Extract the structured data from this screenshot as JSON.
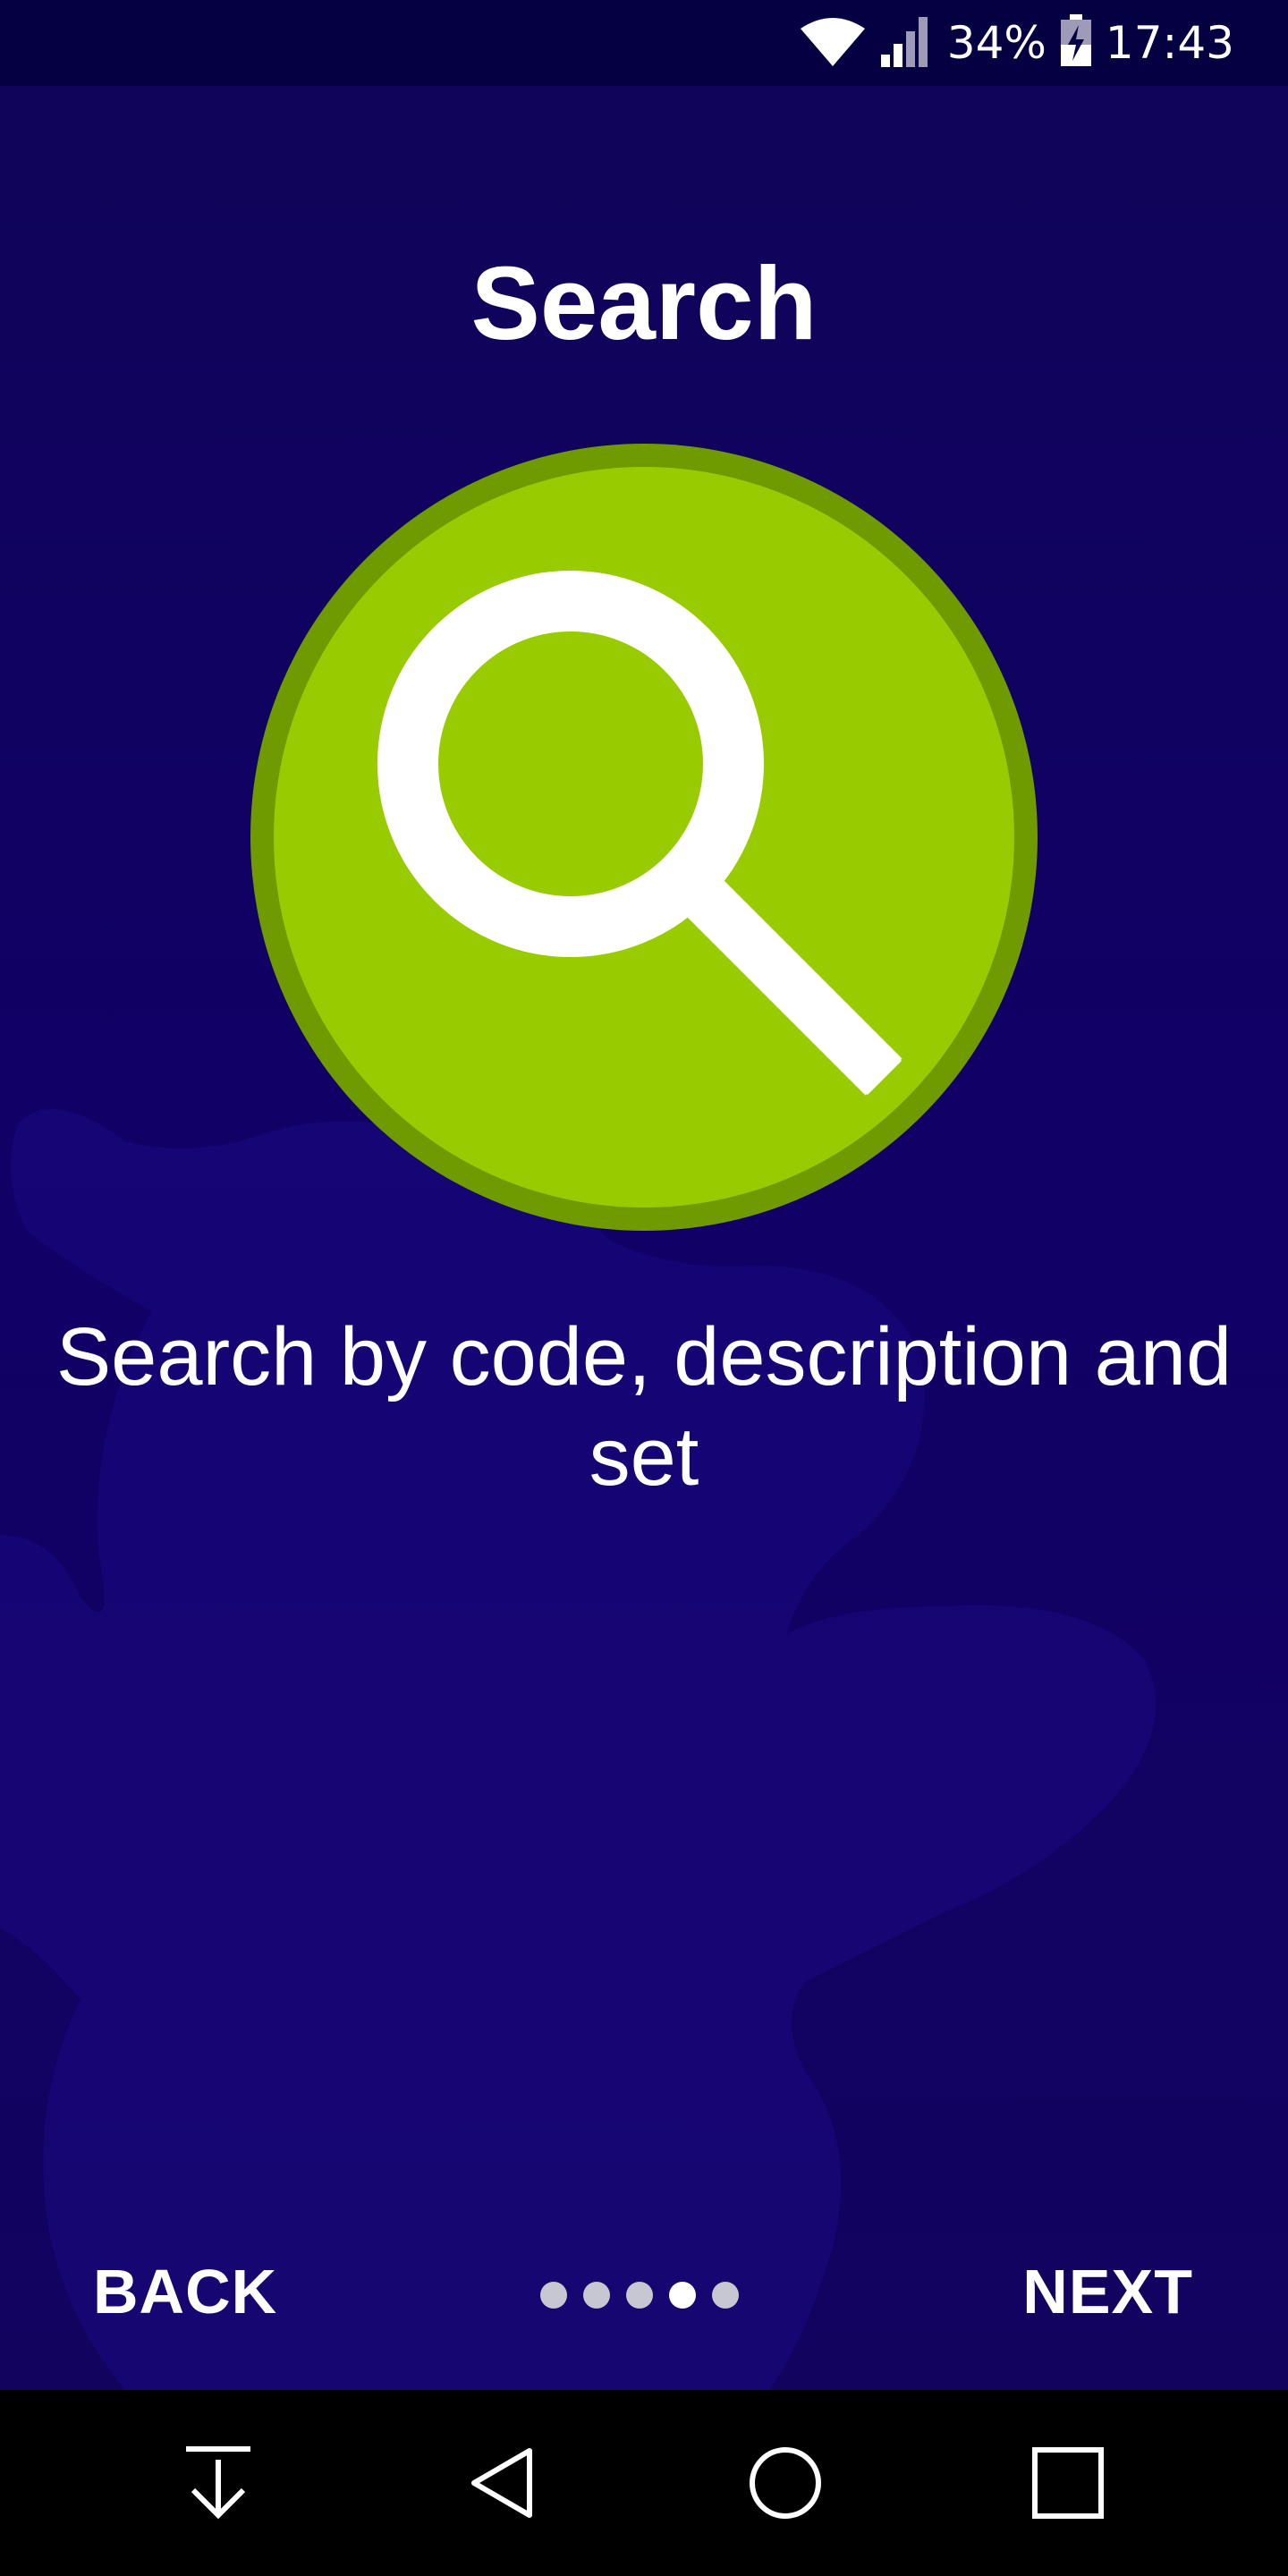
{
  "status_bar": {
    "battery_percent": "34%",
    "time": "17:43",
    "icons": [
      "wifi-icon",
      "signal-icon",
      "battery-charging-icon"
    ]
  },
  "intro": {
    "title": "Search",
    "hero_icon": "magnifier-icon",
    "description": "Search by code, description and set",
    "back_label": "BACK",
    "next_label": "NEXT",
    "page_count": 5,
    "current_page": 4
  },
  "system_nav": {
    "icons": [
      "download-arrow-icon",
      "back-triangle-icon",
      "home-circle-icon",
      "recents-square-icon"
    ]
  },
  "colors": {
    "background": "#110066",
    "status_bar": "#050041",
    "hero_fill": "#99cc00",
    "hero_ring": "#6f9a00",
    "text": "#ffffff"
  }
}
